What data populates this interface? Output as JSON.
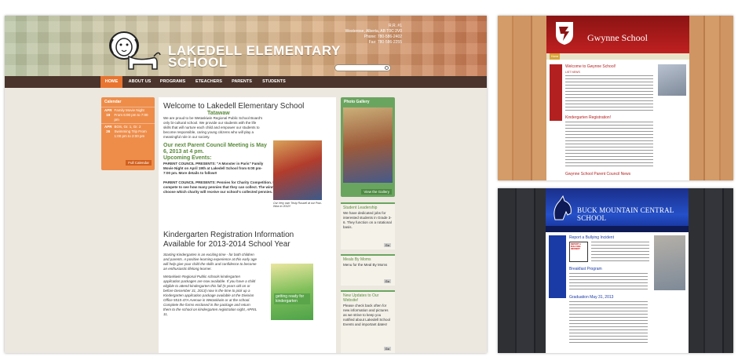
{
  "lakedell": {
    "school_name": [
      "LAKEDELL ELEMENTARY",
      "SCHOOL"
    ],
    "address": [
      "R.R. #1",
      "Westerose, Alberta, AB T0C 2V0",
      "Phone: 780-586-2402",
      "Fax: 780-586-2255"
    ],
    "nav": [
      "HOME",
      "ABOUT US",
      "PROGRAMS",
      "ETEACHERS",
      "PARENTS",
      "STUDENTS"
    ],
    "calendar": {
      "title": "Calendar",
      "events": [
        {
          "day": "APR 19",
          "text": "Family Movie Night From 6:00 pm to 7:00 pm"
        },
        {
          "day": "APR 26",
          "text": "BOS, Gr. 1, Gr. 2 Swimming Trip From 1:00 pm to 2:00 pm"
        }
      ],
      "button": "Full Calendar"
    },
    "main": {
      "title": "Welcome to Lakedell Elementary School",
      "subtitle": "Tatawaw",
      "intro": "We are proud to be Wetaskiwin Regional Public School Board's only bi-cultural school. We provide our students with the life skills that will nurture each child and empower our students to become responsible, caring young citizens who will play a meaningful role in our society.",
      "meeting": "Our next Parent Council Meeting is May 6, 2013 at 4 pm.",
      "upcoming": "Upcoming Events:",
      "event1": "PARENT COUNCIL PRESENTS: \"A Monster in Paris\" Family Movie Night on April 19th at Lakedell School from 6:00 pm-7:00 pm. More details to follow!!",
      "event2": "PARENT COUNCIL PRESENTS: Pennies for Charity Competition. Each classroom will compete to see how many pennies that they can collect. The winning class will get to choose which charity will receive our school's collected pennies.",
      "caption": "Our Very own Tristy Russell at our Pow-Wow in 2012!!",
      "kinder_title": "Kindergarten Registration Information Available for 2013-2014 School Year",
      "kinder_p1": "Starting Kindergarten is an exciting time - for both children and parents. A positive learning experience at this early age will help give your child the skills and confidence to become an enthusiastic lifelong learner.",
      "kinder_p2": "Wetaskiwin Regional Public schools kindergarten application packages are now available. If you have a child eligible to attend kindergarten this fall (5 years old on or before December 31, 2013) now is the time to pick up a Kindergarten application package available at the Division Office 5515-47A Avenue in Wetaskiwin or at the school. Complete the forms enclosed in the package and return them to the school on kindergarten registration night, APRIL 11,",
      "kinder_img_label": "getting ready for kindergarten"
    },
    "gallery": {
      "title": "Photo Gallery",
      "button": "View the Gallery"
    },
    "sidebar": [
      {
        "title": "Student Leadership",
        "text": "We have dedicated jobs for interested students in Grade 3-6. They function on a rotational basis.",
        "button": "Go"
      },
      {
        "title": "Meals By Moms",
        "text": "Menu for the Meal By Moms",
        "button": "Go"
      },
      {
        "title": "New Updates to Our Website!",
        "text": "Please check back often for new information and pictures as we strive to keep you notified about Lakedell School Events and important dates!",
        "button": "Go"
      }
    ]
  },
  "gwynne": {
    "school_name": "Gwynne School",
    "welcome": "Welcome to Gwynne School!",
    "news": "LIST NEWS",
    "kinder": "Kindergarten Registration!",
    "council": "Gwynne School Parent Council News"
  },
  "buck": {
    "school_name": "BUCK MOUNTAIN CENTRAL SCHOOL",
    "report": "Report a Bullying Incident",
    "report_img": "REPORT A BULLYING INCIDENT",
    "breakfast": "Breakfast Program",
    "grad": "Graduation May 31, 2013"
  },
  "colors": {
    "lakedell_nav": "#4a342b",
    "lakedell_accent": "#e8742f",
    "lakedell_green": "#6aa560",
    "gwynne_red": "#b32020",
    "buck_blue": "#1a3aa5"
  }
}
